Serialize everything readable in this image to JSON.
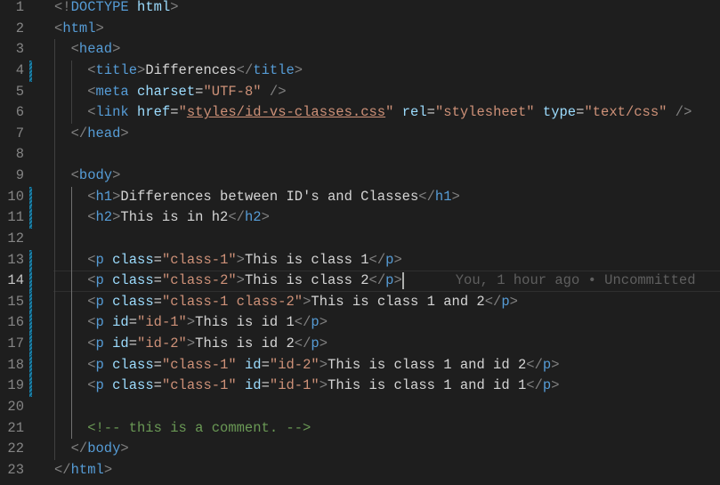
{
  "editor": {
    "current_line": 14,
    "blame": "You, 1 hour ago • Uncommitted",
    "modified_lines": [
      4,
      10,
      11,
      13,
      14,
      15,
      16,
      17,
      18,
      19
    ],
    "colors": {
      "background": "#1e1e1e",
      "tag": "#569cd6",
      "attribute": "#9cdcfe",
      "string": "#ce9178",
      "comment": "#6a9955",
      "text": "#d4d4d4"
    },
    "lines": [
      {
        "n": "1",
        "indent": 0,
        "tokens": [
          [
            "punct",
            "<!"
          ],
          [
            "tag",
            "DOCTYPE"
          ],
          [
            "text",
            " "
          ],
          [
            "attr",
            "html"
          ],
          [
            "punct",
            ">"
          ]
        ]
      },
      {
        "n": "2",
        "indent": 0,
        "tokens": [
          [
            "punct",
            "<"
          ],
          [
            "tag",
            "html"
          ],
          [
            "punct",
            ">"
          ]
        ]
      },
      {
        "n": "3",
        "indent": 1,
        "tokens": [
          [
            "punct",
            "<"
          ],
          [
            "tag",
            "head"
          ],
          [
            "punct",
            ">"
          ]
        ]
      },
      {
        "n": "4",
        "indent": 2,
        "tokens": [
          [
            "punct",
            "<"
          ],
          [
            "tag",
            "title"
          ],
          [
            "punct",
            ">"
          ],
          [
            "text",
            "Differences"
          ],
          [
            "punct",
            "</"
          ],
          [
            "tag",
            "title"
          ],
          [
            "punct",
            ">"
          ]
        ]
      },
      {
        "n": "5",
        "indent": 2,
        "tokens": [
          [
            "punct",
            "<"
          ],
          [
            "tag",
            "meta"
          ],
          [
            "text",
            " "
          ],
          [
            "attr",
            "charset"
          ],
          [
            "text",
            "="
          ],
          [
            "str",
            "\"UTF-8\""
          ],
          [
            "text",
            " "
          ],
          [
            "punct",
            "/>"
          ]
        ]
      },
      {
        "n": "6",
        "indent": 2,
        "tokens": [
          [
            "punct",
            "<"
          ],
          [
            "tag",
            "link"
          ],
          [
            "text",
            " "
          ],
          [
            "attr",
            "href"
          ],
          [
            "text",
            "="
          ],
          [
            "str",
            "\""
          ],
          [
            "link",
            "styles/id-vs-classes.css"
          ],
          [
            "str",
            "\""
          ],
          [
            "text",
            " "
          ],
          [
            "attr",
            "rel"
          ],
          [
            "text",
            "="
          ],
          [
            "str",
            "\"stylesheet\""
          ],
          [
            "text",
            " "
          ],
          [
            "attr",
            "type"
          ],
          [
            "text",
            "="
          ],
          [
            "str",
            "\"text/css\""
          ],
          [
            "text",
            " "
          ],
          [
            "punct",
            "/>"
          ]
        ]
      },
      {
        "n": "7",
        "indent": 1,
        "tokens": [
          [
            "punct",
            "</"
          ],
          [
            "tag",
            "head"
          ],
          [
            "punct",
            ">"
          ]
        ]
      },
      {
        "n": "8",
        "indent": 0,
        "tokens": []
      },
      {
        "n": "9",
        "indent": 1,
        "tokens": [
          [
            "punct",
            "<"
          ],
          [
            "tag",
            "body"
          ],
          [
            "punct",
            ">"
          ]
        ]
      },
      {
        "n": "10",
        "indent": 2,
        "tokens": [
          [
            "punct",
            "<"
          ],
          [
            "tag",
            "h1"
          ],
          [
            "punct",
            ">"
          ],
          [
            "text",
            "Differences between ID's and Classes"
          ],
          [
            "punct",
            "</"
          ],
          [
            "tag",
            "h1"
          ],
          [
            "punct",
            ">"
          ]
        ]
      },
      {
        "n": "11",
        "indent": 2,
        "tokens": [
          [
            "punct",
            "<"
          ],
          [
            "tag",
            "h2"
          ],
          [
            "punct",
            ">"
          ],
          [
            "text",
            "This is in h2"
          ],
          [
            "punct",
            "</"
          ],
          [
            "tag",
            "h2"
          ],
          [
            "punct",
            ">"
          ]
        ]
      },
      {
        "n": "12",
        "indent": 0,
        "tokens": []
      },
      {
        "n": "13",
        "indent": 2,
        "tokens": [
          [
            "punct",
            "<"
          ],
          [
            "tag",
            "p"
          ],
          [
            "text",
            " "
          ],
          [
            "attr",
            "class"
          ],
          [
            "text",
            "="
          ],
          [
            "str",
            "\"class-1\""
          ],
          [
            "punct",
            ">"
          ],
          [
            "text",
            "This is class 1"
          ],
          [
            "punct",
            "</"
          ],
          [
            "tag",
            "p"
          ],
          [
            "punct",
            ">"
          ]
        ]
      },
      {
        "n": "14",
        "indent": 2,
        "tokens": [
          [
            "punct",
            "<"
          ],
          [
            "tag",
            "p"
          ],
          [
            "text",
            " "
          ],
          [
            "attr",
            "class"
          ],
          [
            "text",
            "="
          ],
          [
            "str",
            "\"class-2\""
          ],
          [
            "punct",
            ">"
          ],
          [
            "text",
            "This is class 2"
          ],
          [
            "punct",
            "</"
          ],
          [
            "tag",
            "p"
          ],
          [
            "punct",
            ">"
          ]
        ]
      },
      {
        "n": "15",
        "indent": 2,
        "tokens": [
          [
            "punct",
            "<"
          ],
          [
            "tag",
            "p"
          ],
          [
            "text",
            " "
          ],
          [
            "attr",
            "class"
          ],
          [
            "text",
            "="
          ],
          [
            "str",
            "\"class-1 class-2\""
          ],
          [
            "punct",
            ">"
          ],
          [
            "text",
            "This is class 1 and 2"
          ],
          [
            "punct",
            "</"
          ],
          [
            "tag",
            "p"
          ],
          [
            "punct",
            ">"
          ]
        ]
      },
      {
        "n": "16",
        "indent": 2,
        "tokens": [
          [
            "punct",
            "<"
          ],
          [
            "tag",
            "p"
          ],
          [
            "text",
            " "
          ],
          [
            "attr",
            "id"
          ],
          [
            "text",
            "="
          ],
          [
            "str",
            "\"id-1\""
          ],
          [
            "punct",
            ">"
          ],
          [
            "text",
            "This is id 1"
          ],
          [
            "punct",
            "</"
          ],
          [
            "tag",
            "p"
          ],
          [
            "punct",
            ">"
          ]
        ]
      },
      {
        "n": "17",
        "indent": 2,
        "tokens": [
          [
            "punct",
            "<"
          ],
          [
            "tag",
            "p"
          ],
          [
            "text",
            " "
          ],
          [
            "attr",
            "id"
          ],
          [
            "text",
            "="
          ],
          [
            "str",
            "\"id-2\""
          ],
          [
            "punct",
            ">"
          ],
          [
            "text",
            "This is id 2"
          ],
          [
            "punct",
            "</"
          ],
          [
            "tag",
            "p"
          ],
          [
            "punct",
            ">"
          ]
        ]
      },
      {
        "n": "18",
        "indent": 2,
        "tokens": [
          [
            "punct",
            "<"
          ],
          [
            "tag",
            "p"
          ],
          [
            "text",
            " "
          ],
          [
            "attr",
            "class"
          ],
          [
            "text",
            "="
          ],
          [
            "str",
            "\"class-1\""
          ],
          [
            "text",
            " "
          ],
          [
            "attr",
            "id"
          ],
          [
            "text",
            "="
          ],
          [
            "str",
            "\"id-2\""
          ],
          [
            "punct",
            ">"
          ],
          [
            "text",
            "This is class 1 and id 2"
          ],
          [
            "punct",
            "</"
          ],
          [
            "tag",
            "p"
          ],
          [
            "punct",
            ">"
          ]
        ]
      },
      {
        "n": "19",
        "indent": 2,
        "tokens": [
          [
            "punct",
            "<"
          ],
          [
            "tag",
            "p"
          ],
          [
            "text",
            " "
          ],
          [
            "attr",
            "class"
          ],
          [
            "text",
            "="
          ],
          [
            "str",
            "\"class-1\""
          ],
          [
            "text",
            " "
          ],
          [
            "attr",
            "id"
          ],
          [
            "text",
            "="
          ],
          [
            "str",
            "\"id-1\""
          ],
          [
            "punct",
            ">"
          ],
          [
            "text",
            "This is class 1 and id 1"
          ],
          [
            "punct",
            "</"
          ],
          [
            "tag",
            "p"
          ],
          [
            "punct",
            ">"
          ]
        ]
      },
      {
        "n": "20",
        "indent": 0,
        "tokens": []
      },
      {
        "n": "21",
        "indent": 2,
        "tokens": [
          [
            "comment",
            "<!-- this is a comment. -->"
          ]
        ]
      },
      {
        "n": "22",
        "indent": 1,
        "tokens": [
          [
            "punct",
            "</"
          ],
          [
            "tag",
            "body"
          ],
          [
            "punct",
            ">"
          ]
        ]
      },
      {
        "n": "23",
        "indent": 0,
        "tokens": [
          [
            "punct",
            "</"
          ],
          [
            "tag",
            "html"
          ],
          [
            "punct",
            ">"
          ]
        ]
      }
    ]
  }
}
